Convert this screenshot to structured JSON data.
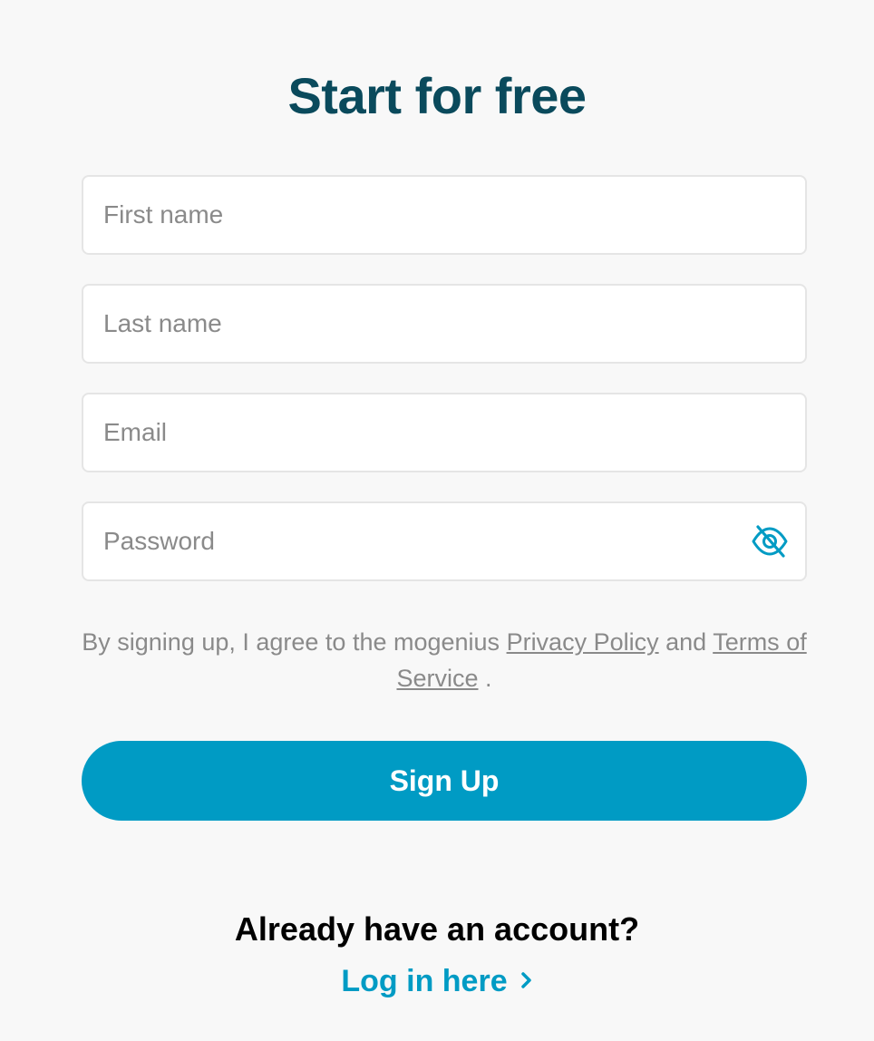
{
  "header": {
    "title": "Start for free"
  },
  "form": {
    "first_name": {
      "value": "",
      "placeholder": "First name"
    },
    "last_name": {
      "value": "",
      "placeholder": "Last name"
    },
    "email": {
      "value": "",
      "placeholder": "Email"
    },
    "password": {
      "value": "",
      "placeholder": "Password",
      "toggle_icon": "eye-off-icon"
    }
  },
  "terms": {
    "prefix": "By signing up, I agree to the mogenius ",
    "privacy_link": "Privacy Policy",
    "conjunction": " and ",
    "terms_link": "Terms of Service",
    "suffix": " ."
  },
  "signup": {
    "label": "Sign Up"
  },
  "login": {
    "question": "Already have an account?",
    "link_label": "Log in here",
    "link_icon": "chevron-right-icon"
  },
  "colors": {
    "title": "#0a4a5c",
    "accent": "#009bc4",
    "background": "#f8f8f8",
    "muted_text": "#8a8a8a"
  }
}
